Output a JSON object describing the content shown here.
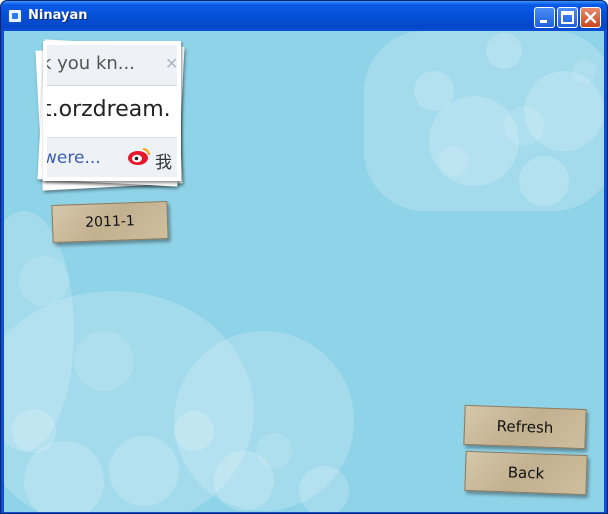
{
  "window": {
    "title": "Ninayan",
    "controls": [
      "minimize-icon",
      "maximize-icon",
      "close-icon"
    ]
  },
  "album": {
    "thumbnail_text": {
      "line1": "k you kn...",
      "line2": "t.orzdream.",
      "line3": "were...",
      "line3_cn": "我"
    },
    "date_label": "2011-1"
  },
  "actions": {
    "refresh_label": "Refresh",
    "back_label": "Back"
  },
  "colors": {
    "background": "#8fd3e8",
    "titlebar": "#0a5ae8",
    "tag": "#c9b99b"
  }
}
